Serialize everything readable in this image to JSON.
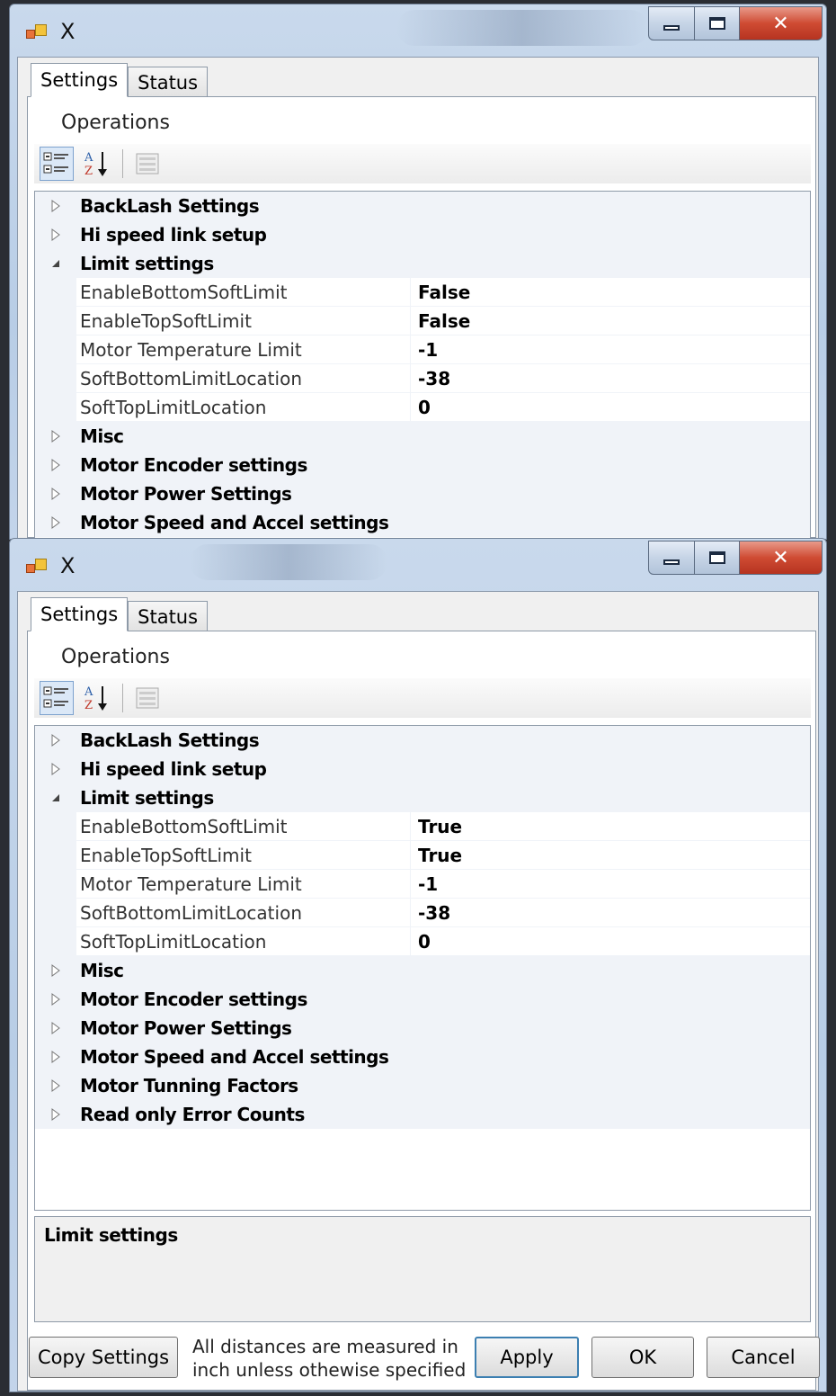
{
  "windows": [
    {
      "title": "X",
      "tabs": [
        "Settings",
        "Status"
      ],
      "operations_label": "Operations",
      "grid_rows": [
        {
          "type": "category",
          "label": "BackLash Settings",
          "expanded": false
        },
        {
          "type": "category",
          "label": "Hi speed link setup",
          "expanded": false
        },
        {
          "type": "category",
          "label": "Limit settings",
          "expanded": true
        },
        {
          "type": "property",
          "name": "EnableBottomSoftLimit",
          "value": "False"
        },
        {
          "type": "property",
          "name": "EnableTopSoftLimit",
          "value": "False"
        },
        {
          "type": "property",
          "name": "Motor Temperature Limit",
          "value": "-1"
        },
        {
          "type": "property",
          "name": "SoftBottomLimitLocation",
          "value": "-38"
        },
        {
          "type": "property",
          "name": "SoftTopLimitLocation",
          "value": "0"
        },
        {
          "type": "category",
          "label": "Misc",
          "expanded": false
        },
        {
          "type": "category",
          "label": "Motor Encoder settings",
          "expanded": false
        },
        {
          "type": "category",
          "label": "Motor Power Settings",
          "expanded": false
        },
        {
          "type": "category",
          "label": "Motor Speed and Accel settings",
          "expanded": false
        }
      ]
    },
    {
      "title": "X",
      "tabs": [
        "Settings",
        "Status"
      ],
      "operations_label": "Operations",
      "grid_rows": [
        {
          "type": "category",
          "label": "BackLash Settings",
          "expanded": false
        },
        {
          "type": "category",
          "label": "Hi speed link setup",
          "expanded": false
        },
        {
          "type": "category",
          "label": "Limit settings",
          "expanded": true
        },
        {
          "type": "property",
          "name": "EnableBottomSoftLimit",
          "value": "True"
        },
        {
          "type": "property",
          "name": "EnableTopSoftLimit",
          "value": "True"
        },
        {
          "type": "property",
          "name": "Motor Temperature Limit",
          "value": "-1"
        },
        {
          "type": "property",
          "name": "SoftBottomLimitLocation",
          "value": "-38"
        },
        {
          "type": "property",
          "name": "SoftTopLimitLocation",
          "value": "0"
        },
        {
          "type": "category",
          "label": "Misc",
          "expanded": false
        },
        {
          "type": "category",
          "label": "Motor Encoder settings",
          "expanded": false
        },
        {
          "type": "category",
          "label": "Motor Power Settings",
          "expanded": false
        },
        {
          "type": "category",
          "label": "Motor Speed and Accel settings",
          "expanded": false
        },
        {
          "type": "category",
          "label": "Motor Tunning Factors",
          "expanded": false
        },
        {
          "type": "category",
          "label": "Read only Error Counts",
          "expanded": false
        }
      ],
      "description_title": "Limit settings",
      "footer": {
        "copy_settings": "Copy Settings",
        "note": "All distances are measured in inch unless othewise specified",
        "apply": "Apply",
        "ok": "OK",
        "cancel": "Cancel"
      }
    }
  ],
  "icons": {
    "categorized": "categorized-view-icon",
    "alphabetical": "sort-alphabetical-icon",
    "property_pages": "property-pages-icon",
    "collapsed": "triangle-right",
    "expanded": "triangle-down"
  },
  "colors": {
    "title_bar": "#c2d4ea",
    "close_button": "#cf4b33",
    "category_bg": "#f0f3f8"
  }
}
